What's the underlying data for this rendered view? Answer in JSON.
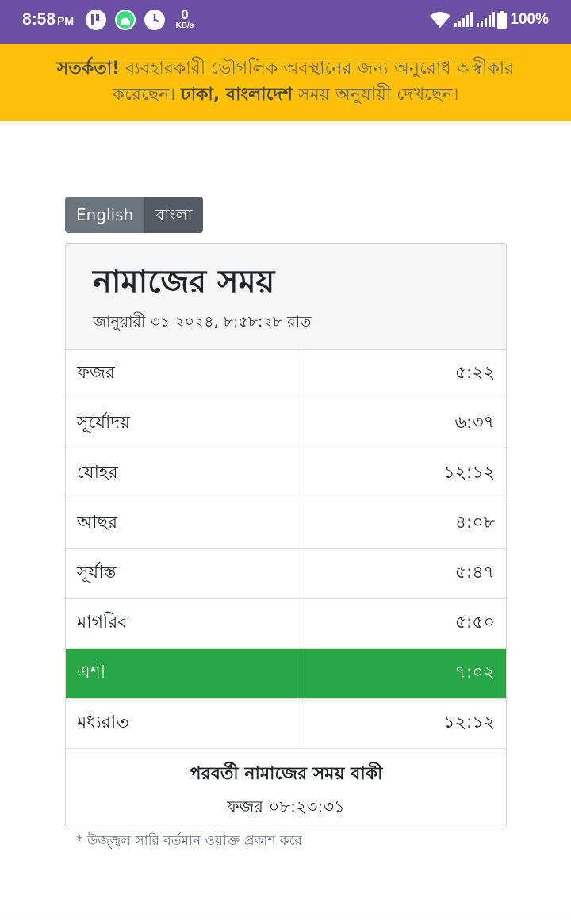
{
  "status_bar": {
    "time": "8:58",
    "ampm": "PM",
    "speed_value": "0",
    "speed_unit": "KB/s",
    "battery": "100%",
    "icons": [
      "app-icon",
      "android-icon",
      "clock-icon",
      "wifi-icon",
      "signal-icon",
      "signal-icon",
      "battery-icon"
    ]
  },
  "alert": {
    "strong_warning": "সতর্কতা!",
    "text_before": " ব্যবহারকারী ভৌগলিক অবস্থানের জন্য অনুরোধ অস্বীকার করেছেন। ",
    "location": "ঢাকা, বাংলাদেশ",
    "text_after": " সময় অনুযায়ী দেখছেন।",
    "color": "#ffc107"
  },
  "language": {
    "english": "English",
    "bangla": "বাংলা",
    "selected": "বাংলা"
  },
  "card": {
    "title": "নামাজের সময়",
    "date": "জানুয়ারী ৩১ ২০২৪, ৮:৫৮:২৮ রাত"
  },
  "prayers": [
    {
      "name": "ফজর",
      "time": "৫:২২"
    },
    {
      "name": "সূর্যোদয়",
      "time": "৬:৩৭"
    },
    {
      "name": "যোহর",
      "time": "১২:১২"
    },
    {
      "name": "আছর",
      "time": "৪:০৮"
    },
    {
      "name": "সূর্যাস্ত",
      "time": "৫:৪৭"
    },
    {
      "name": "মাগরিব",
      "time": "৫:৫০"
    },
    {
      "name": "এশা",
      "time": "৭:০২",
      "active": true
    },
    {
      "name": "মধ্যরাত",
      "time": "১২:১২"
    }
  ],
  "active_color": "#28a745",
  "next_prayer": {
    "title": "পরবর্তী নামাজের সময় বাকী",
    "value": "ফজর ০৮:২৩:৩১"
  },
  "footnote": "* উজ্জ্বল সারি বর্তমান ওয়াক্ত প্রকাশ করে"
}
